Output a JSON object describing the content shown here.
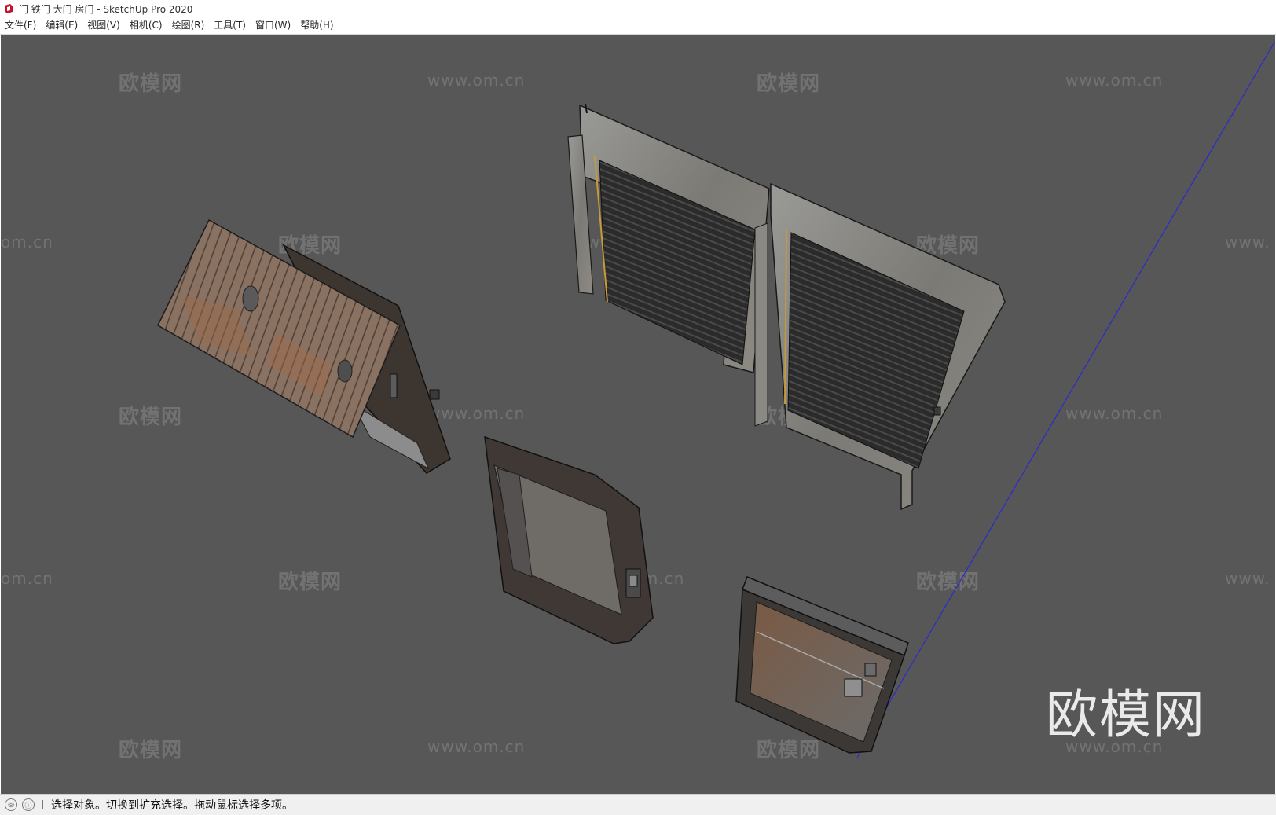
{
  "window": {
    "title": "门 铁门 大门 房门 - SketchUp Pro 2020"
  },
  "menu": [
    {
      "label": "文件(F)"
    },
    {
      "label": "编辑(E)"
    },
    {
      "label": "视图(V)"
    },
    {
      "label": "相机(C)"
    },
    {
      "label": "绘图(R)"
    },
    {
      "label": "工具(T)"
    },
    {
      "label": "窗口(W)"
    },
    {
      "label": "帮助(H)"
    }
  ],
  "viewport": {
    "background": "#575757",
    "watermark_brand": "欧模网",
    "watermark_url": "www.om.cn",
    "watermark_url_partial_left": "om.cn",
    "watermark_url_partial_right": "www.",
    "logo_text": "欧模网"
  },
  "status": {
    "message": "选择对象。切换到扩充选择。拖动鼠标选择多项。",
    "icons": [
      "geo-location-icon",
      "credits-info-icon"
    ]
  }
}
